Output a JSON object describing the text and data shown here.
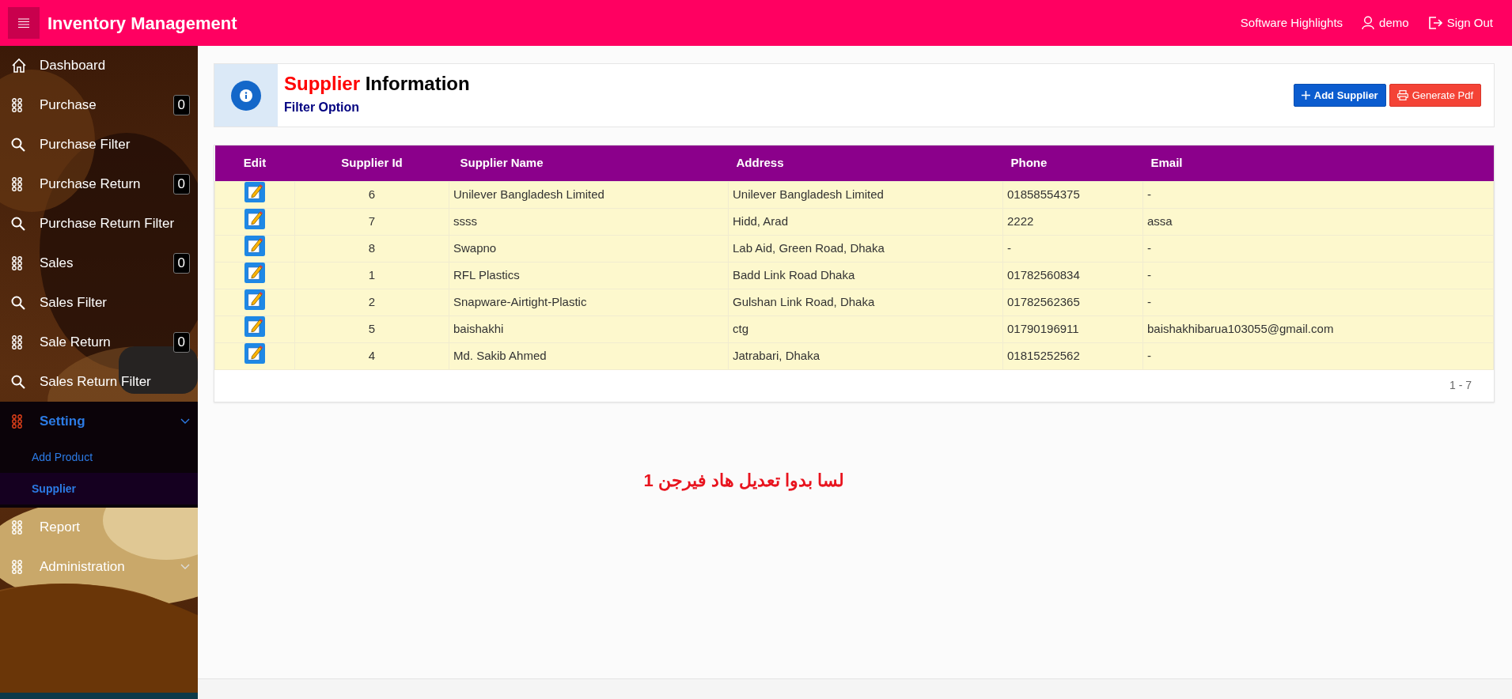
{
  "app": {
    "title": "Inventory Management"
  },
  "top_links": [
    {
      "label": "Software Highlights",
      "kind": "plain"
    },
    {
      "label": "demo",
      "kind": "account"
    },
    {
      "label": "Sign Out",
      "kind": "logout"
    }
  ],
  "sidebar": {
    "items": [
      {
        "label": "Dashboard",
        "kind": "home",
        "selected": false
      },
      {
        "label": "Purchase",
        "kind": "group",
        "badge": "0",
        "selected": false
      },
      {
        "label": "Purchase Filter",
        "kind": "filter",
        "selected": false
      },
      {
        "label": "Purchase Return",
        "kind": "group",
        "badge": "0",
        "selected": false
      },
      {
        "label": "Purchase Return Filter",
        "kind": "filter",
        "selected": false
      },
      {
        "label": "Sales",
        "kind": "group",
        "badge": "0",
        "selected": false
      },
      {
        "label": "Sales Filter",
        "kind": "filter",
        "selected": false
      },
      {
        "label": "Sale Return",
        "kind": "group",
        "badge": "0",
        "selected": false
      },
      {
        "label": "Sales Return Filter",
        "kind": "filter",
        "selected": false
      },
      {
        "label": "Setting",
        "kind": "group",
        "selected": true,
        "expanded": true,
        "children": [
          {
            "label": "Add Product",
            "selected": false
          },
          {
            "label": "Supplier",
            "selected": true
          }
        ]
      },
      {
        "label": "Report",
        "kind": "group",
        "selected": false
      },
      {
        "label": "Administration",
        "kind": "group",
        "selected": false,
        "expanded": false
      }
    ]
  },
  "header": {
    "title_accent": "Supplier",
    "title_rest": "Information",
    "subtitle": "Filter Option",
    "buttons": [
      {
        "label": "Add Supplier",
        "kind": "primary"
      },
      {
        "label": "Generate Pdf",
        "kind": "danger"
      }
    ]
  },
  "table": {
    "columns": [
      "Edit",
      "Supplier Id",
      "Supplier Name",
      "Address",
      "Phone",
      "Email"
    ],
    "rows": [
      [
        "",
        "6",
        "Unilever Bangladesh Limited",
        "Unilever Bangladesh Limited",
        "01858554375",
        "-"
      ],
      [
        "",
        "7",
        "ssss",
        "Hidd, Arad",
        "2222",
        "assa"
      ],
      [
        "",
        "8",
        "Swapno",
        "Lab Aid, Green Road, Dhaka",
        "-",
        "-"
      ],
      [
        "",
        "1",
        "RFL Plastics",
        "Badd Link Road Dhaka",
        "01782560834",
        "-"
      ],
      [
        "",
        "2",
        "Snapware-Airtight-Plastic",
        "Gulshan Link Road, Dhaka",
        "01782562365",
        "-"
      ],
      [
        "",
        "5",
        "baishakhi",
        "ctg",
        "01790196911",
        "baishakhibarua103055@gmail.com"
      ],
      [
        "",
        "4",
        "Md. Sakib Ahmed",
        "Jatrabari, Dhaka",
        "01815252562",
        "-"
      ]
    ],
    "pagination": "1 - 7"
  },
  "note": "لسا بدوا تعديل هاد فيرجن 1"
}
